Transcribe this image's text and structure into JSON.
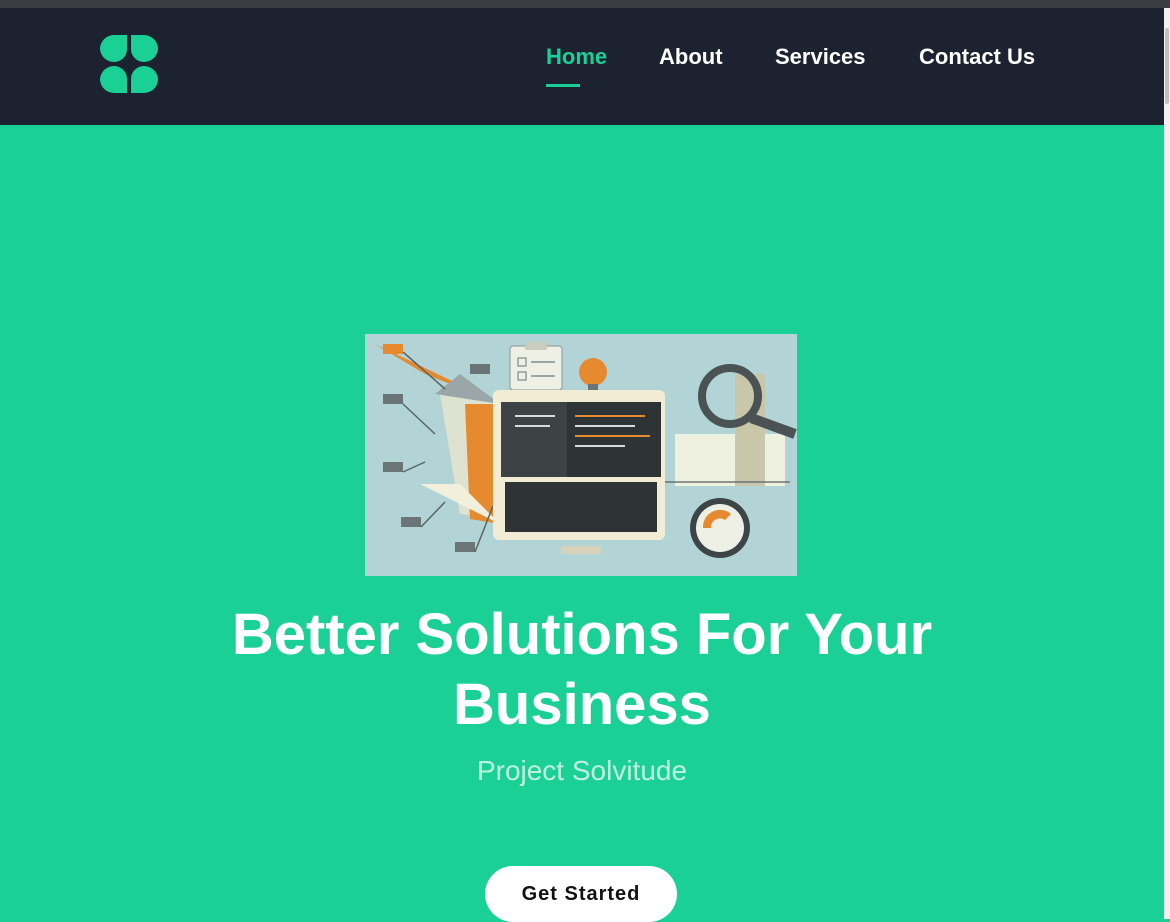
{
  "nav": {
    "items": [
      {
        "label": "Home",
        "active": true
      },
      {
        "label": "About",
        "active": false
      },
      {
        "label": "Services",
        "active": false
      },
      {
        "label": "Contact Us",
        "active": false
      }
    ]
  },
  "hero": {
    "title": "Better Solutions For Your Business",
    "subtitle": "Project Solvitude",
    "cta_label": "Get Started"
  },
  "colors": {
    "accent": "#1ad095",
    "navbar_bg": "#1d2230",
    "text_on_accent": "#ffffff"
  },
  "icons": {
    "logo": "four-petal-logo-icon"
  }
}
